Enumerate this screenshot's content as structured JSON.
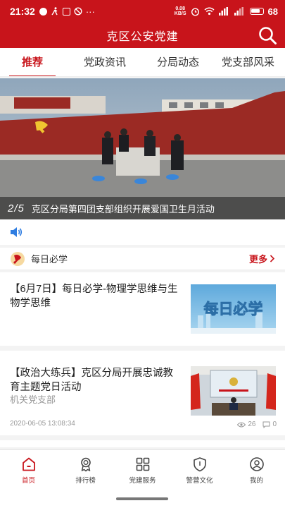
{
  "status_bar": {
    "time": "21:32",
    "more": "···",
    "net_speed_value": "0.08",
    "net_speed_unit": "KB/S",
    "battery": "68"
  },
  "app": {
    "title": "克区公安党建"
  },
  "tabs": [
    {
      "label": "推荐",
      "active": true
    },
    {
      "label": "党政资讯",
      "active": false
    },
    {
      "label": "分局动态",
      "active": false
    },
    {
      "label": "党支部风采",
      "active": false
    }
  ],
  "banner": {
    "page_current": "2",
    "page_total": "5",
    "caption": "克区分局第四团支部组织开展爱国卫生月活动"
  },
  "daily": {
    "label": "每日必学",
    "more": "更多"
  },
  "articles": [
    {
      "title": "【6月7日】每日必学-物理学思维与生物学思维",
      "thumb_text": "每日必学"
    },
    {
      "title": "【政治大练兵】克区分局开展忠诚教育主题党日活动",
      "source": "机关党支部",
      "date": "2020-06-05 13:08:34",
      "views": "26",
      "comments": "0"
    }
  ],
  "bottom_nav": [
    {
      "label": "首页",
      "icon": "home-icon",
      "active": true
    },
    {
      "label": "排行榜",
      "icon": "medal-icon",
      "active": false
    },
    {
      "label": "党建服务",
      "icon": "grid-icon",
      "active": false
    },
    {
      "label": "警营文化",
      "icon": "shield-icon",
      "active": false
    },
    {
      "label": "我的",
      "icon": "user-icon",
      "active": false
    }
  ],
  "colors": {
    "brand_red": "#c8141b",
    "accent_blue": "#2f7de1"
  }
}
